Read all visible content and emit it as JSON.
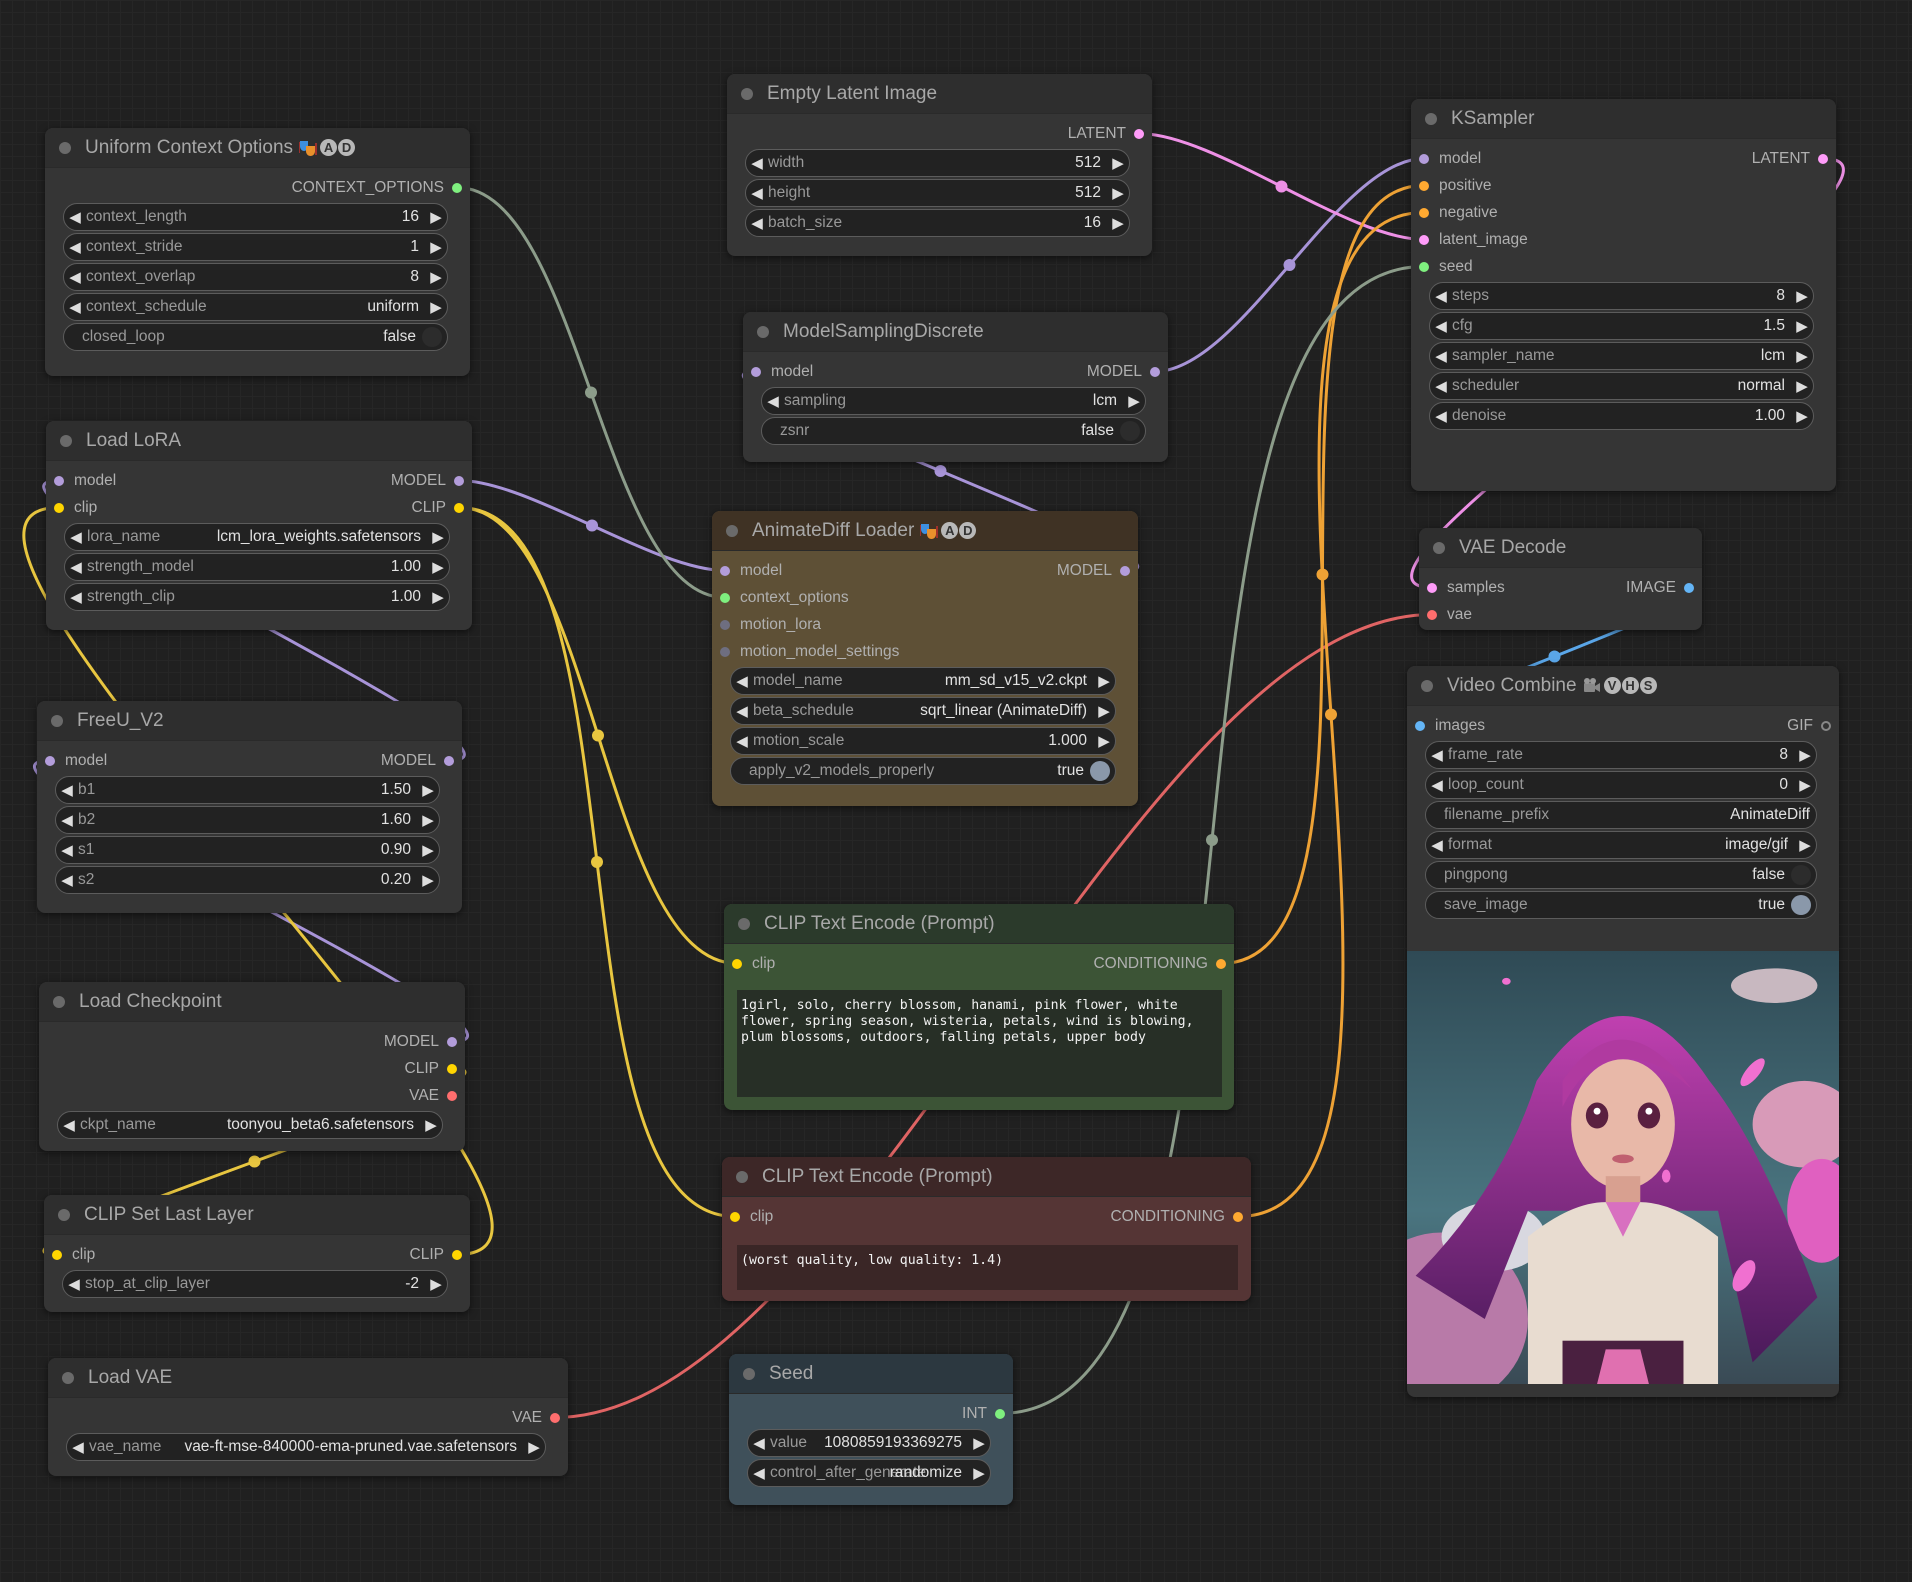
{
  "colors": {
    "MODEL": "#b39ddb",
    "CLIP": "#ffd500",
    "CONDITIONING": "#ffa931",
    "LATENT": "#ff9cf9",
    "VAE": "#ff6e6e",
    "IMAGE": "#64b5f6",
    "INT": "#7ff07f",
    "CONTEXT_OPTIONS": "#7ff07f",
    "UNCONNECTED": "#6e6e80",
    "GIF": "#888888"
  },
  "nodes": {
    "uniform": {
      "title": "Uniform Context Options",
      "badge_icon": "theater-masks-icon",
      "badge": [
        "A",
        "D"
      ],
      "inputs": [],
      "outputs": [
        {
          "label": "CONTEXT_OPTIONS",
          "type": "CONTEXT_OPTIONS"
        }
      ],
      "widgets": [
        {
          "label": "context_length",
          "value": "16",
          "type": "number"
        },
        {
          "label": "context_stride",
          "value": "1",
          "type": "number"
        },
        {
          "label": "context_overlap",
          "value": "8",
          "type": "number"
        },
        {
          "label": "context_schedule",
          "value": "uniform",
          "type": "combo"
        },
        {
          "label": "closed_loop",
          "value": "false",
          "type": "toggle",
          "on": false
        }
      ]
    },
    "empty_latent": {
      "title": "Empty Latent Image",
      "inputs": [],
      "outputs": [
        {
          "label": "LATENT",
          "type": "LATENT"
        }
      ],
      "widgets": [
        {
          "label": "width",
          "value": "512",
          "type": "number"
        },
        {
          "label": "height",
          "value": "512",
          "type": "number"
        },
        {
          "label": "batch_size",
          "value": "16",
          "type": "number"
        }
      ]
    },
    "ksampler": {
      "title": "KSampler",
      "inputs": [
        {
          "label": "model",
          "type": "MODEL"
        },
        {
          "label": "positive",
          "type": "CONDITIONING"
        },
        {
          "label": "negative",
          "type": "CONDITIONING"
        },
        {
          "label": "latent_image",
          "type": "LATENT"
        },
        {
          "label": "seed",
          "type": "INT"
        }
      ],
      "outputs": [
        {
          "label": "LATENT",
          "type": "LATENT"
        }
      ],
      "widgets": [
        {
          "label": "steps",
          "value": "8",
          "type": "number"
        },
        {
          "label": "cfg",
          "value": "1.5",
          "type": "number"
        },
        {
          "label": "sampler_name",
          "value": "lcm",
          "type": "combo"
        },
        {
          "label": "scheduler",
          "value": "normal",
          "type": "combo"
        },
        {
          "label": "denoise",
          "value": "1.00",
          "type": "number"
        }
      ]
    },
    "msd": {
      "title": "ModelSamplingDiscrete",
      "inputs": [
        {
          "label": "model",
          "type": "MODEL"
        }
      ],
      "outputs": [
        {
          "label": "MODEL",
          "type": "MODEL"
        }
      ],
      "widgets": [
        {
          "label": "sampling",
          "value": "lcm",
          "type": "combo"
        },
        {
          "label": "zsnr",
          "value": "false",
          "type": "toggle",
          "on": false
        }
      ]
    },
    "lora": {
      "title": "Load LoRA",
      "inputs": [
        {
          "label": "model",
          "type": "MODEL"
        },
        {
          "label": "clip",
          "type": "CLIP"
        }
      ],
      "outputs": [
        {
          "label": "MODEL",
          "type": "MODEL"
        },
        {
          "label": "CLIP",
          "type": "CLIP"
        }
      ],
      "widgets": [
        {
          "label": "lora_name",
          "value": "lcm_lora_weights.safetensors",
          "type": "combo"
        },
        {
          "label": "strength_model",
          "value": "1.00",
          "type": "number"
        },
        {
          "label": "strength_clip",
          "value": "1.00",
          "type": "number"
        }
      ]
    },
    "animatediff": {
      "title": "AnimateDiff Loader",
      "badge_icon": "theater-masks-icon",
      "badge": [
        "A",
        "D"
      ],
      "theme": "brown",
      "inputs": [
        {
          "label": "model",
          "type": "MODEL"
        },
        {
          "label": "context_options",
          "type": "CONTEXT_OPTIONS"
        },
        {
          "label": "motion_lora",
          "type": "UNCONNECTED"
        },
        {
          "label": "motion_model_settings",
          "type": "UNCONNECTED"
        }
      ],
      "outputs": [
        {
          "label": "MODEL",
          "type": "MODEL"
        }
      ],
      "widgets": [
        {
          "label": "model_name",
          "value": "mm_sd_v15_v2.ckpt",
          "type": "combo"
        },
        {
          "label": "beta_schedule",
          "value": "sqrt_linear (AnimateDiff)",
          "type": "combo"
        },
        {
          "label": "motion_scale",
          "value": "1.000",
          "type": "number"
        },
        {
          "label": "apply_v2_models_properly",
          "value": "true",
          "type": "toggle",
          "on": true
        }
      ]
    },
    "vae_decode": {
      "title": "VAE Decode",
      "inputs": [
        {
          "label": "samples",
          "type": "LATENT"
        },
        {
          "label": "vae",
          "type": "VAE"
        }
      ],
      "outputs": [
        {
          "label": "IMAGE",
          "type": "IMAGE"
        }
      ],
      "widgets": []
    },
    "freeu": {
      "title": "FreeU_V2",
      "inputs": [
        {
          "label": "model",
          "type": "MODEL"
        }
      ],
      "outputs": [
        {
          "label": "MODEL",
          "type": "MODEL"
        }
      ],
      "widgets": [
        {
          "label": "b1",
          "value": "1.50",
          "type": "number"
        },
        {
          "label": "b2",
          "value": "1.60",
          "type": "number"
        },
        {
          "label": "s1",
          "value": "0.90",
          "type": "number"
        },
        {
          "label": "s2",
          "value": "0.20",
          "type": "number"
        }
      ]
    },
    "video": {
      "title": "Video Combine",
      "badge_icon": "film-camera-icon",
      "badge": [
        "V",
        "H",
        "S"
      ],
      "inputs": [
        {
          "label": "images",
          "type": "IMAGE"
        }
      ],
      "outputs": [
        {
          "label": "GIF",
          "type": "GIF"
        }
      ],
      "widgets": [
        {
          "label": "frame_rate",
          "value": "8",
          "type": "number"
        },
        {
          "label": "loop_count",
          "value": "0",
          "type": "number"
        },
        {
          "label": "filename_prefix",
          "value": "AnimateDiff",
          "type": "text"
        },
        {
          "label": "format",
          "value": "image/gif",
          "type": "combo"
        },
        {
          "label": "pingpong",
          "value": "false",
          "type": "toggle",
          "on": false
        },
        {
          "label": "save_image",
          "value": "true",
          "type": "toggle",
          "on": true
        }
      ],
      "preview": true
    },
    "clip_pos": {
      "title": "CLIP Text Encode (Prompt)",
      "theme": "green",
      "inputs": [
        {
          "label": "clip",
          "type": "CLIP"
        }
      ],
      "outputs": [
        {
          "label": "CONDITIONING",
          "type": "CONDITIONING"
        }
      ],
      "widgets": [],
      "text": "1girl, solo, cherry blossom, hanami, pink flower, white flower, spring season, wisteria, petals, wind is blowing, plum blossoms, outdoors, falling petals, upper body"
    },
    "checkpoint": {
      "title": "Load Checkpoint",
      "inputs": [],
      "outputs": [
        {
          "label": "MODEL",
          "type": "MODEL"
        },
        {
          "label": "CLIP",
          "type": "CLIP"
        },
        {
          "label": "VAE",
          "type": "VAE"
        }
      ],
      "widgets": [
        {
          "label": "ckpt_name",
          "value": "toonyou_beta6.safetensors",
          "type": "combo"
        }
      ]
    },
    "clip_neg": {
      "title": "CLIP Text Encode (Prompt)",
      "theme": "red",
      "inputs": [
        {
          "label": "clip",
          "type": "CLIP"
        }
      ],
      "outputs": [
        {
          "label": "CONDITIONING",
          "type": "CONDITIONING"
        }
      ],
      "widgets": [],
      "text": "(worst quality, low quality: 1.4)"
    },
    "clip_last": {
      "title": "CLIP Set Last Layer",
      "inputs": [
        {
          "label": "clip",
          "type": "CLIP"
        }
      ],
      "outputs": [
        {
          "label": "CLIP",
          "type": "CLIP"
        }
      ],
      "widgets": [
        {
          "label": "stop_at_clip_layer",
          "value": "-2",
          "type": "number"
        }
      ]
    },
    "load_vae": {
      "title": "Load VAE",
      "inputs": [],
      "outputs": [
        {
          "label": "VAE",
          "type": "VAE"
        }
      ],
      "widgets": [
        {
          "label": "vae_name",
          "value": "vae-ft-mse-840000-ema-pruned.vae.safetensors",
          "type": "combo"
        }
      ]
    },
    "seed": {
      "title": "Seed",
      "theme": "blue",
      "inputs": [],
      "outputs": [
        {
          "label": "INT",
          "type": "INT"
        }
      ],
      "widgets": [
        {
          "label": "value",
          "value": "1080859193369275",
          "type": "number"
        },
        {
          "label": "control_after_generate",
          "value": "randomize",
          "type": "combo"
        }
      ]
    }
  }
}
